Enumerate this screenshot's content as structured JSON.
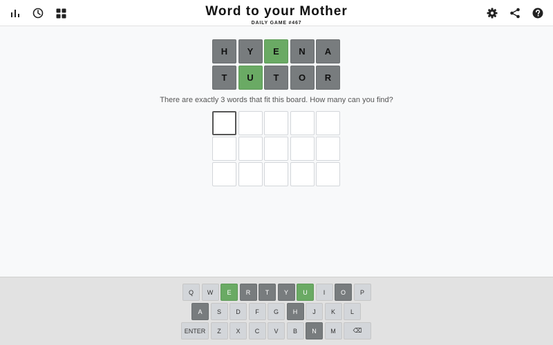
{
  "header": {
    "title": "Word to your Mother",
    "subtitle": "DAILY GAME #467",
    "left_icons": [
      "stats-icon",
      "history-icon",
      "grid-icon"
    ],
    "right_icons": [
      "gear-icon",
      "share-icon",
      "help-icon"
    ]
  },
  "board": {
    "rows": [
      [
        {
          "letter": "H",
          "state": "gray"
        },
        {
          "letter": "Y",
          "state": "gray"
        },
        {
          "letter": "E",
          "state": "green"
        },
        {
          "letter": "N",
          "state": "gray"
        },
        {
          "letter": "A",
          "state": "gray"
        }
      ],
      [
        {
          "letter": "T",
          "state": "gray"
        },
        {
          "letter": "U",
          "state": "green"
        },
        {
          "letter": "T",
          "state": "gray"
        },
        {
          "letter": "O",
          "state": "gray"
        },
        {
          "letter": "R",
          "state": "gray"
        }
      ]
    ]
  },
  "prompt": "There are exactly 3 words that fit this board. How many can you find?",
  "guesses": {
    "rows": 3,
    "columns": 5,
    "active_row": 0,
    "active_column": 0
  },
  "keyboard": {
    "rows": [
      [
        {
          "label": "Q",
          "state": "default"
        },
        {
          "label": "W",
          "state": "default"
        },
        {
          "label": "E",
          "state": "green"
        },
        {
          "label": "R",
          "state": "gray"
        },
        {
          "label": "T",
          "state": "gray"
        },
        {
          "label": "Y",
          "state": "gray"
        },
        {
          "label": "U",
          "state": "green"
        },
        {
          "label": "I",
          "state": "default"
        },
        {
          "label": "O",
          "state": "gray"
        },
        {
          "label": "P",
          "state": "default"
        }
      ],
      [
        {
          "label": "A",
          "state": "gray"
        },
        {
          "label": "S",
          "state": "default"
        },
        {
          "label": "D",
          "state": "default"
        },
        {
          "label": "F",
          "state": "default"
        },
        {
          "label": "G",
          "state": "default"
        },
        {
          "label": "H",
          "state": "gray"
        },
        {
          "label": "J",
          "state": "default"
        },
        {
          "label": "K",
          "state": "default"
        },
        {
          "label": "L",
          "state": "default"
        }
      ],
      [
        {
          "label": "ENTER",
          "state": "default",
          "wide": true
        },
        {
          "label": "Z",
          "state": "default"
        },
        {
          "label": "X",
          "state": "default"
        },
        {
          "label": "C",
          "state": "default"
        },
        {
          "label": "V",
          "state": "default"
        },
        {
          "label": "B",
          "state": "default"
        },
        {
          "label": "N",
          "state": "gray"
        },
        {
          "label": "M",
          "state": "default"
        },
        {
          "label": "⌫",
          "state": "default",
          "wide": true
        }
      ]
    ]
  },
  "colors": {
    "green": "#6aaa64",
    "gray": "#787c7e",
    "key_default": "#d3d6da",
    "background": "#f8f9fa"
  }
}
